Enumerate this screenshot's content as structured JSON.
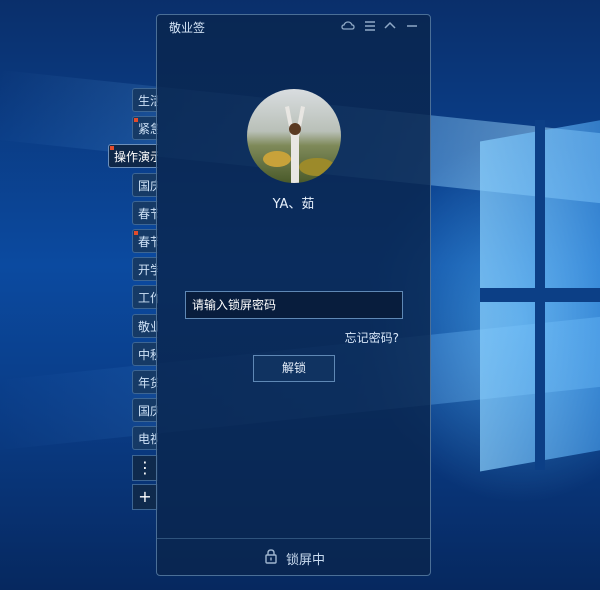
{
  "app": {
    "title": "敬业签"
  },
  "titlebar": {
    "icons": [
      "cloud-sync-icon",
      "menu-icon",
      "collapse-icon",
      "minimize-icon"
    ]
  },
  "side_tabs": {
    "items": [
      {
        "label": "生活",
        "marked": false,
        "active": false
      },
      {
        "label": "紧急",
        "marked": true,
        "active": false
      },
      {
        "label": "操作演示",
        "marked": true,
        "active": true
      },
      {
        "label": "国庆",
        "marked": false,
        "active": false
      },
      {
        "label": "春节",
        "marked": false,
        "active": false
      },
      {
        "label": "春节",
        "marked": true,
        "active": false
      },
      {
        "label": "开学",
        "marked": false,
        "active": false
      },
      {
        "label": "工作",
        "marked": false,
        "active": false
      },
      {
        "label": "敬业",
        "marked": false,
        "active": false
      },
      {
        "label": "中秋",
        "marked": false,
        "active": false
      },
      {
        "label": "年货",
        "marked": false,
        "active": false
      },
      {
        "label": "国庆",
        "marked": false,
        "active": false
      },
      {
        "label": "电视",
        "marked": false,
        "active": false
      }
    ],
    "more_label": "⋮",
    "add_label": "+"
  },
  "lock_screen": {
    "username": "YA、茹",
    "password_placeholder": "请输入锁屏密码",
    "password_value": "",
    "forgot_label": "忘记密码?",
    "unlock_label": "解锁",
    "status_text": "锁屏中"
  },
  "colors": {
    "accent_marker": "#e24b2c",
    "window_bg": "#0a264e"
  }
}
